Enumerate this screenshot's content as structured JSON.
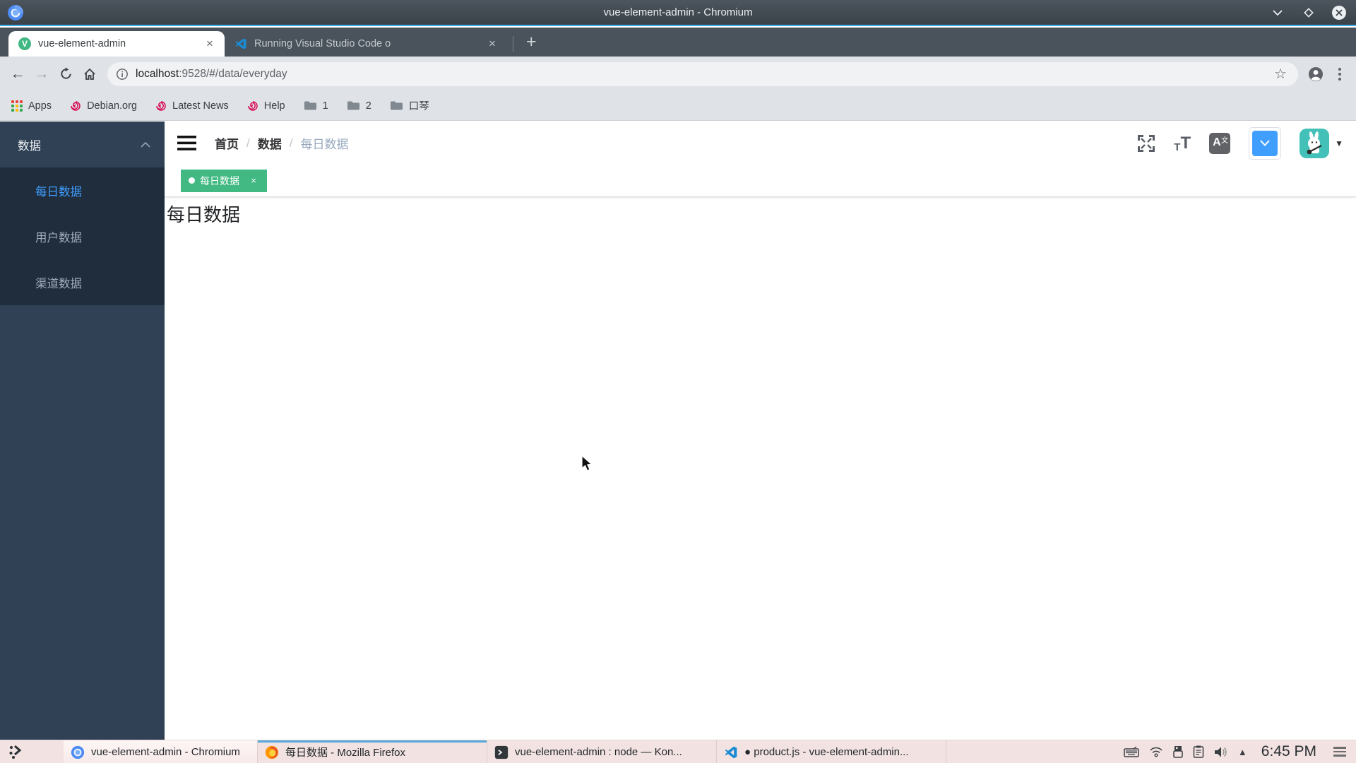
{
  "window": {
    "title": "vue-element-admin - Chromium",
    "controls": {
      "minimize": "minimize",
      "maximize": "maximize",
      "close": "close"
    }
  },
  "browser": {
    "tabs": [
      {
        "title": "vue-element-admin",
        "favicon": "vue-logo",
        "close": "×"
      },
      {
        "title": "Running Visual Studio Code o",
        "favicon": "vscode-logo",
        "close": "×"
      }
    ],
    "new_tab": "+",
    "favicon_letter": "V",
    "address": {
      "host": "localhost",
      "path": ":9528/#/data/everyday",
      "star": "☆"
    },
    "bookmarks": [
      {
        "label": "Apps",
        "icon": "apps-grid"
      },
      {
        "label": "Debian.org",
        "icon": "debian"
      },
      {
        "label": "Latest News",
        "icon": "debian"
      },
      {
        "label": "Help",
        "icon": "debian"
      },
      {
        "label": "1",
        "icon": "folder"
      },
      {
        "label": "2",
        "icon": "folder"
      },
      {
        "label": "口琴",
        "icon": "folder"
      }
    ]
  },
  "app": {
    "sidebar": {
      "header": "数据",
      "items": [
        {
          "label": "每日数据",
          "active": true
        },
        {
          "label": "用户数据",
          "active": false
        },
        {
          "label": "渠道数据",
          "active": false
        }
      ]
    },
    "breadcrumb": {
      "items": [
        {
          "label": "首页"
        },
        {
          "label": "数据"
        },
        {
          "label": "每日数据"
        }
      ],
      "separator": "/"
    },
    "toolbar_icons": {
      "size_small_t": "T",
      "size_big_t": "T",
      "lang_a": "A",
      "lang_x": "文"
    },
    "tag": {
      "label": "每日数据",
      "close": "×"
    },
    "content_title": "每日数据",
    "colors": {
      "accent_blue": "#409eff",
      "tag_green": "#42b983",
      "sidebar_bg": "#304156",
      "submenu_bg": "#1f2d3d"
    }
  },
  "taskbar": {
    "tasks": [
      {
        "title": "vue-element-admin - Chromium",
        "icon": "chromium",
        "active": true
      },
      {
        "title": "每日数据 - Mozilla Firefox",
        "icon": "firefox",
        "active": false
      },
      {
        "title": "vue-element-admin : node — Kon...",
        "icon": "konsole",
        "active": false
      },
      {
        "title": "● product.js - vue-element-admin...",
        "icon": "vscode",
        "active": false
      }
    ],
    "tray": [
      "keyboard",
      "wifi",
      "usb",
      "clipboard",
      "volume",
      "caret-up"
    ],
    "caret_up": "▲",
    "clock": "6:45 PM"
  }
}
